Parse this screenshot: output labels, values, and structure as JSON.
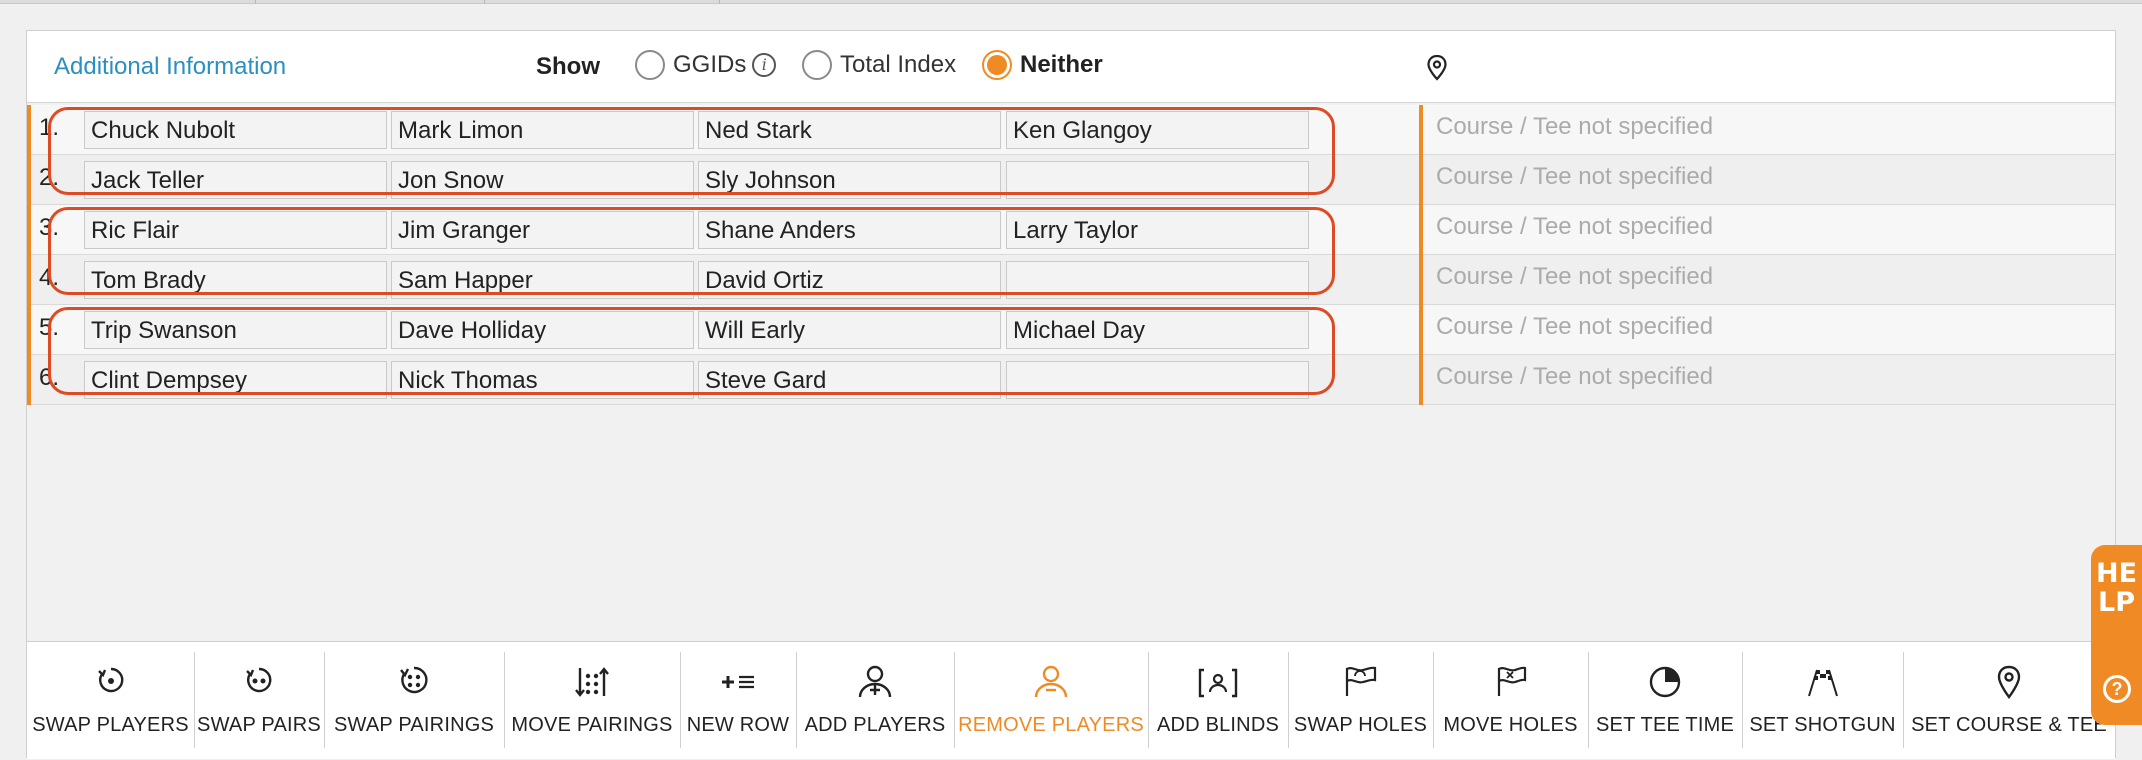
{
  "header": {
    "additional_info": "Additional Information",
    "show_label": "Show",
    "options": [
      {
        "label": "GGIDs",
        "selected": false,
        "has_info": true
      },
      {
        "label": "Total Index",
        "selected": false,
        "has_info": false
      },
      {
        "label": "Neither",
        "selected": true,
        "has_info": false
      }
    ],
    "info_glyph": "i",
    "pin_icon": "map-pin-icon"
  },
  "rows": [
    {
      "num": "1.",
      "players": [
        "Chuck Nubolt",
        "Mark Limon",
        "Ned Stark",
        "Ken Glangoy"
      ],
      "course": "Course / Tee not specified"
    },
    {
      "num": "2.",
      "players": [
        "Jack Teller",
        "Jon Snow",
        "Sly Johnson",
        ""
      ],
      "course": "Course / Tee not specified"
    },
    {
      "num": "3.",
      "players": [
        "Ric Flair",
        "Jim Granger",
        "Shane Anders",
        "Larry Taylor"
      ],
      "course": "Course / Tee not specified"
    },
    {
      "num": "4.",
      "players": [
        "Tom Brady",
        "Sam Happer",
        "David Ortiz",
        ""
      ],
      "course": "Course / Tee not specified"
    },
    {
      "num": "5.",
      "players": [
        "Trip Swanson",
        "Dave Holliday",
        "Will Early",
        "Michael Day"
      ],
      "course": "Course / Tee not specified"
    },
    {
      "num": "6.",
      "players": [
        "Clint Dempsey",
        "Nick Thomas",
        "Steve Gard",
        ""
      ],
      "course": "Course / Tee not specified"
    }
  ],
  "toolbar": [
    {
      "label": "SWAP PLAYERS",
      "icon": "swap-players-icon",
      "active": false
    },
    {
      "label": "SWAP PAIRS",
      "icon": "swap-pairs-icon",
      "active": false
    },
    {
      "label": "SWAP PAIRINGS",
      "icon": "swap-pairings-icon",
      "active": false
    },
    {
      "label": "MOVE PAIRINGS",
      "icon": "move-pairings-icon",
      "active": false
    },
    {
      "label": "NEW ROW",
      "icon": "new-row-icon",
      "active": false
    },
    {
      "label": "ADD PLAYERS",
      "icon": "add-player-icon",
      "active": false
    },
    {
      "label": "REMOVE PLAYERS",
      "icon": "remove-player-icon",
      "active": true
    },
    {
      "label": "ADD BLINDS",
      "icon": "add-blinds-icon",
      "active": false
    },
    {
      "label": "SWAP HOLES",
      "icon": "swap-holes-flag-icon",
      "active": false
    },
    {
      "label": "MOVE HOLES",
      "icon": "move-holes-flag-icon",
      "active": false
    },
    {
      "label": "SET TEE TIME",
      "icon": "clock-icon",
      "active": false
    },
    {
      "label": "SET SHOTGUN",
      "icon": "checkered-flags-icon",
      "active": false
    },
    {
      "label": "SET COURSE & TEE",
      "icon": "map-pin-icon",
      "active": false
    }
  ],
  "help": {
    "label": "HELP",
    "glyph": "?"
  },
  "colors": {
    "accent": "#f08a24",
    "link": "#2a8fc1",
    "outline": "#dd4b24",
    "muted": "#ababab"
  }
}
